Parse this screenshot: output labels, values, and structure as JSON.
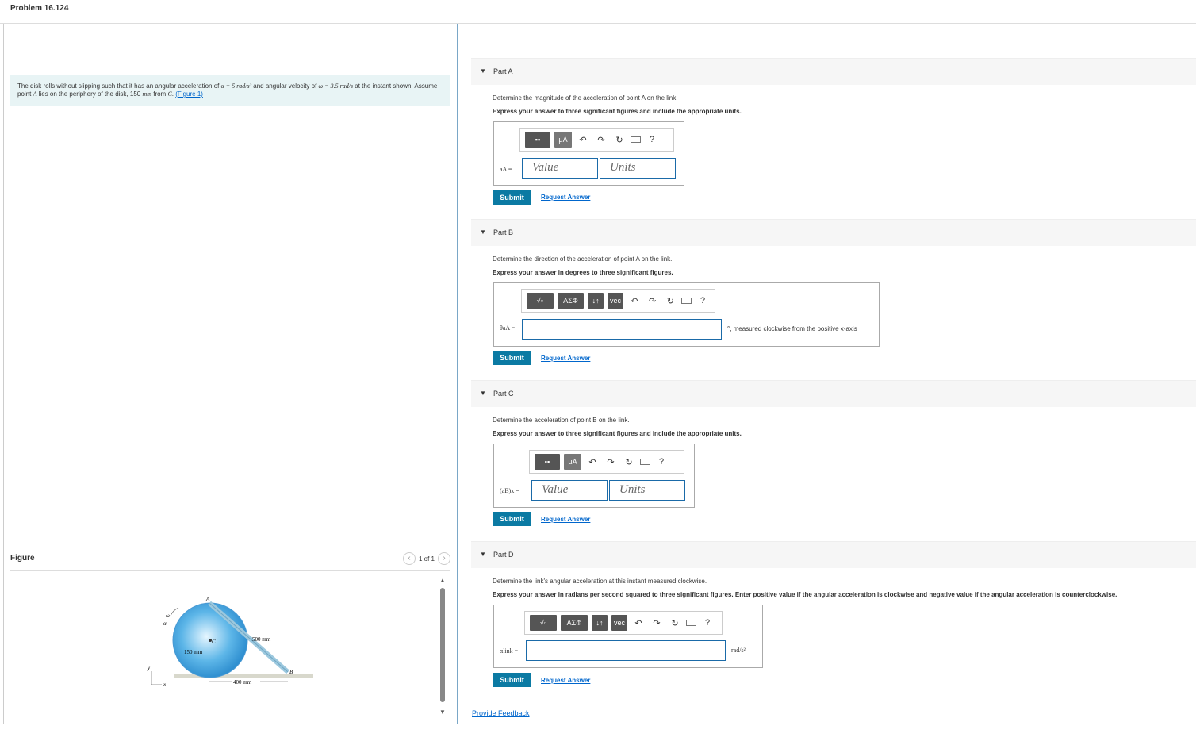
{
  "page_title": "Problem 16.124",
  "problem": {
    "text_1": "The disk rolls without slipping such that it has an angular acceleration of ",
    "alpha": "α = 5 rad/s²",
    "text_2": " and angular velocity of ",
    "omega": "ω = 3.5 rad/s",
    "text_3": " at the instant shown. Assume point ",
    "pointA": "A",
    "text_4": " lies on the periphery of the disk, 150 ",
    "mm": "mm",
    "text_5": " from ",
    "pointC": "C",
    "text_6": ". ",
    "figure_link": "(Figure 1)"
  },
  "figure": {
    "title": "Figure",
    "pager": "1 of 1",
    "labels": {
      "omega": "ω",
      "alpha": "α",
      "a": "A",
      "c": "C",
      "b": "B",
      "dim150": "150 mm",
      "dim500": "500 mm",
      "dim400": "400 mm",
      "y": "y",
      "x": "x"
    }
  },
  "toolbar": {
    "greek": "ΑΣΦ",
    "unit_mu": "μA",
    "help": "?",
    "undo_icon": "undo-icon",
    "redo_icon": "redo-icon",
    "reset_icon": "reset-icon",
    "keyboard_icon": "keyboard-icon"
  },
  "parts": [
    {
      "title": "Part A",
      "question": "Determine the magnitude of the acceleration of point A on the link.",
      "instruction": "Express your answer to three significant figures and include the appropriate units.",
      "label": "aA =",
      "value_placeholder": "Value",
      "units_placeholder": "Units",
      "submit": "Submit",
      "request": "Request Answer"
    },
    {
      "title": "Part B",
      "question": "Determine the direction of the acceleration of point A on the link.",
      "instruction": "Express your answer in degrees to three significant figures.",
      "label": "θaA =",
      "suffix": "°, measured clockwise from the positive x-axis",
      "submit": "Submit",
      "request": "Request Answer"
    },
    {
      "title": "Part C",
      "question": "Determine the acceleration of point B on the link.",
      "instruction": "Express your answer to three significant figures and include the appropriate units.",
      "label": "(aB)x =",
      "value_placeholder": "Value",
      "units_placeholder": "Units",
      "submit": "Submit",
      "request": "Request Answer"
    },
    {
      "title": "Part D",
      "question": "Determine the link's angular acceleration at this instant measured clockwise.",
      "instruction": "Express your answer in radians per second squared to three significant figures. Enter positive value if the angular acceleration is clockwise and negative value if the angular acceleration is counterclockwise.",
      "label": "αlink =",
      "suffix": "rad/s²",
      "submit": "Submit",
      "request": "Request Answer"
    }
  ],
  "feedback": "Provide Feedback",
  "colors": {
    "submit": "#0b7aa3",
    "link": "#0066cc",
    "problem_bg": "#e8f4f5"
  }
}
